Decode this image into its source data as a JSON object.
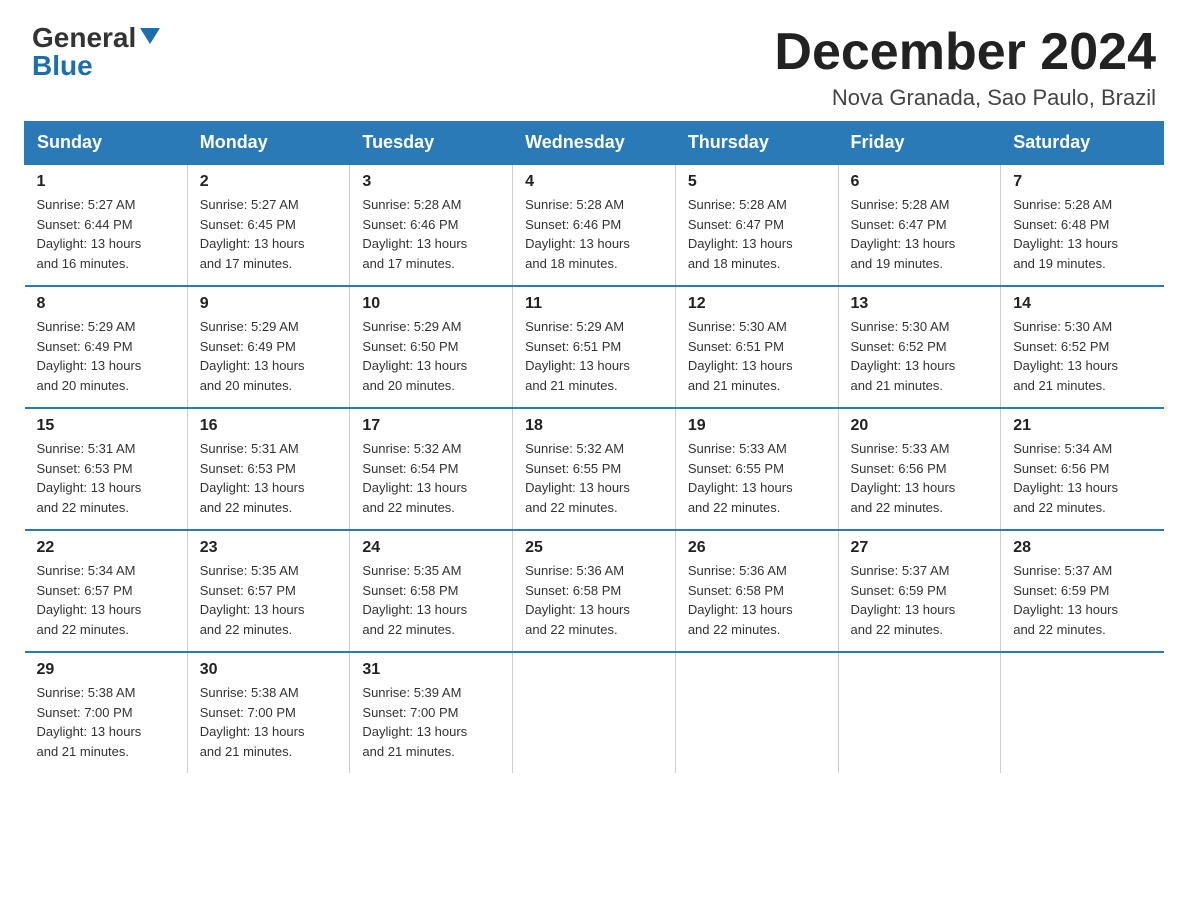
{
  "logo": {
    "general": "General",
    "blue": "Blue"
  },
  "title": "December 2024",
  "subtitle": "Nova Granada, Sao Paulo, Brazil",
  "days_header": [
    "Sunday",
    "Monday",
    "Tuesday",
    "Wednesday",
    "Thursday",
    "Friday",
    "Saturday"
  ],
  "weeks": [
    [
      {
        "day": "1",
        "sunrise": "5:27 AM",
        "sunset": "6:44 PM",
        "daylight": "13 hours and 16 minutes."
      },
      {
        "day": "2",
        "sunrise": "5:27 AM",
        "sunset": "6:45 PM",
        "daylight": "13 hours and 17 minutes."
      },
      {
        "day": "3",
        "sunrise": "5:28 AM",
        "sunset": "6:46 PM",
        "daylight": "13 hours and 17 minutes."
      },
      {
        "day": "4",
        "sunrise": "5:28 AM",
        "sunset": "6:46 PM",
        "daylight": "13 hours and 18 minutes."
      },
      {
        "day": "5",
        "sunrise": "5:28 AM",
        "sunset": "6:47 PM",
        "daylight": "13 hours and 18 minutes."
      },
      {
        "day": "6",
        "sunrise": "5:28 AM",
        "sunset": "6:47 PM",
        "daylight": "13 hours and 19 minutes."
      },
      {
        "day": "7",
        "sunrise": "5:28 AM",
        "sunset": "6:48 PM",
        "daylight": "13 hours and 19 minutes."
      }
    ],
    [
      {
        "day": "8",
        "sunrise": "5:29 AM",
        "sunset": "6:49 PM",
        "daylight": "13 hours and 20 minutes."
      },
      {
        "day": "9",
        "sunrise": "5:29 AM",
        "sunset": "6:49 PM",
        "daylight": "13 hours and 20 minutes."
      },
      {
        "day": "10",
        "sunrise": "5:29 AM",
        "sunset": "6:50 PM",
        "daylight": "13 hours and 20 minutes."
      },
      {
        "day": "11",
        "sunrise": "5:29 AM",
        "sunset": "6:51 PM",
        "daylight": "13 hours and 21 minutes."
      },
      {
        "day": "12",
        "sunrise": "5:30 AM",
        "sunset": "6:51 PM",
        "daylight": "13 hours and 21 minutes."
      },
      {
        "day": "13",
        "sunrise": "5:30 AM",
        "sunset": "6:52 PM",
        "daylight": "13 hours and 21 minutes."
      },
      {
        "day": "14",
        "sunrise": "5:30 AM",
        "sunset": "6:52 PM",
        "daylight": "13 hours and 21 minutes."
      }
    ],
    [
      {
        "day": "15",
        "sunrise": "5:31 AM",
        "sunset": "6:53 PM",
        "daylight": "13 hours and 22 minutes."
      },
      {
        "day": "16",
        "sunrise": "5:31 AM",
        "sunset": "6:53 PM",
        "daylight": "13 hours and 22 minutes."
      },
      {
        "day": "17",
        "sunrise": "5:32 AM",
        "sunset": "6:54 PM",
        "daylight": "13 hours and 22 minutes."
      },
      {
        "day": "18",
        "sunrise": "5:32 AM",
        "sunset": "6:55 PM",
        "daylight": "13 hours and 22 minutes."
      },
      {
        "day": "19",
        "sunrise": "5:33 AM",
        "sunset": "6:55 PM",
        "daylight": "13 hours and 22 minutes."
      },
      {
        "day": "20",
        "sunrise": "5:33 AM",
        "sunset": "6:56 PM",
        "daylight": "13 hours and 22 minutes."
      },
      {
        "day": "21",
        "sunrise": "5:34 AM",
        "sunset": "6:56 PM",
        "daylight": "13 hours and 22 minutes."
      }
    ],
    [
      {
        "day": "22",
        "sunrise": "5:34 AM",
        "sunset": "6:57 PM",
        "daylight": "13 hours and 22 minutes."
      },
      {
        "day": "23",
        "sunrise": "5:35 AM",
        "sunset": "6:57 PM",
        "daylight": "13 hours and 22 minutes."
      },
      {
        "day": "24",
        "sunrise": "5:35 AM",
        "sunset": "6:58 PM",
        "daylight": "13 hours and 22 minutes."
      },
      {
        "day": "25",
        "sunrise": "5:36 AM",
        "sunset": "6:58 PM",
        "daylight": "13 hours and 22 minutes."
      },
      {
        "day": "26",
        "sunrise": "5:36 AM",
        "sunset": "6:58 PM",
        "daylight": "13 hours and 22 minutes."
      },
      {
        "day": "27",
        "sunrise": "5:37 AM",
        "sunset": "6:59 PM",
        "daylight": "13 hours and 22 minutes."
      },
      {
        "day": "28",
        "sunrise": "5:37 AM",
        "sunset": "6:59 PM",
        "daylight": "13 hours and 22 minutes."
      }
    ],
    [
      {
        "day": "29",
        "sunrise": "5:38 AM",
        "sunset": "7:00 PM",
        "daylight": "13 hours and 21 minutes."
      },
      {
        "day": "30",
        "sunrise": "5:38 AM",
        "sunset": "7:00 PM",
        "daylight": "13 hours and 21 minutes."
      },
      {
        "day": "31",
        "sunrise": "5:39 AM",
        "sunset": "7:00 PM",
        "daylight": "13 hours and 21 minutes."
      },
      null,
      null,
      null,
      null
    ]
  ],
  "labels": {
    "sunrise": "Sunrise:",
    "sunset": "Sunset:",
    "daylight": "Daylight:"
  }
}
